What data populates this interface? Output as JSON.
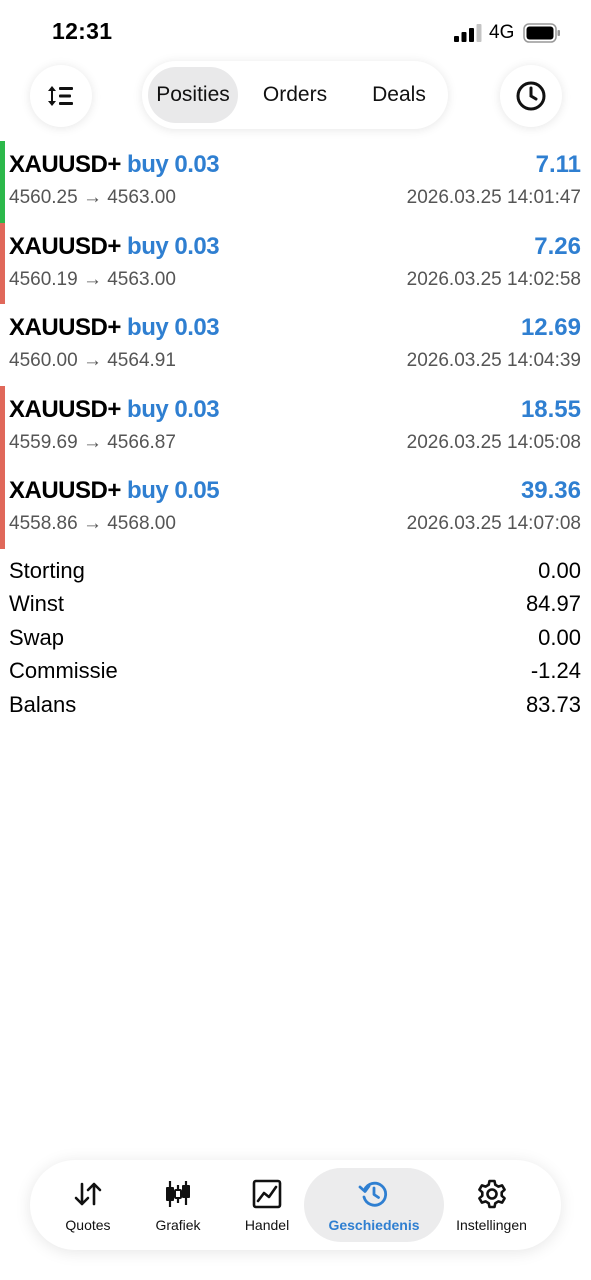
{
  "status_bar": {
    "time": "12:31",
    "network": "4G"
  },
  "toolbar": {
    "sort_icon": "sort-icon",
    "history_icon": "clock-icon",
    "tabs": [
      {
        "label": "Posities",
        "active": true
      },
      {
        "label": "Orders",
        "active": false
      },
      {
        "label": "Deals",
        "active": false
      }
    ]
  },
  "trades": [
    {
      "symbol": "XAUUSD+",
      "side": "buy 0.03",
      "profit": "7.11",
      "prices": "4560.25 → 4563.00",
      "time": "2026.03.25 14:01:47",
      "marker_color": "#2cb84a"
    },
    {
      "symbol": "XAUUSD+",
      "side": "buy 0.03",
      "profit": "7.26",
      "prices": "4560.19 → 4563.00",
      "time": "2026.03.25 14:02:58",
      "marker_color": "#e0685a"
    },
    {
      "symbol": "XAUUSD+",
      "side": "buy 0.03",
      "profit": "12.69",
      "prices": "4560.00 → 4564.91",
      "time": "2026.03.25 14:04:39",
      "marker_color": "#ffffff"
    },
    {
      "symbol": "XAUUSD+",
      "side": "buy 0.03",
      "profit": "18.55",
      "prices": "4559.69 → 4566.87",
      "time": "2026.03.25 14:05:08",
      "marker_color": "#e0685a"
    },
    {
      "symbol": "XAUUSD+",
      "side": "buy 0.05",
      "profit": "39.36",
      "prices": "4558.86 → 4568.00",
      "time": "2026.03.25 14:07:08",
      "marker_color": "#e0685a"
    }
  ],
  "summary": [
    {
      "label": "Storting",
      "value": "0.00"
    },
    {
      "label": "Winst",
      "value": "84.97"
    },
    {
      "label": "Swap",
      "value": "0.00"
    },
    {
      "label": "Commissie",
      "value": "-1.24"
    },
    {
      "label": "Balans",
      "value": "83.73"
    }
  ],
  "tab_bar": {
    "items": [
      {
        "label": "Quotes",
        "icon": "quotes-icon",
        "active": false
      },
      {
        "label": "Grafiek",
        "icon": "candlestick-icon",
        "active": false
      },
      {
        "label": "Handel",
        "icon": "trade-chart-icon",
        "active": false
      },
      {
        "label": "Geschiedenis",
        "icon": "history-icon",
        "active": true
      },
      {
        "label": "Instellingen",
        "icon": "gear-icon",
        "active": false
      }
    ]
  },
  "colors": {
    "accent": "#2f7fd1",
    "positive_marker": "#2cb84a",
    "negative_marker": "#e0685a"
  }
}
